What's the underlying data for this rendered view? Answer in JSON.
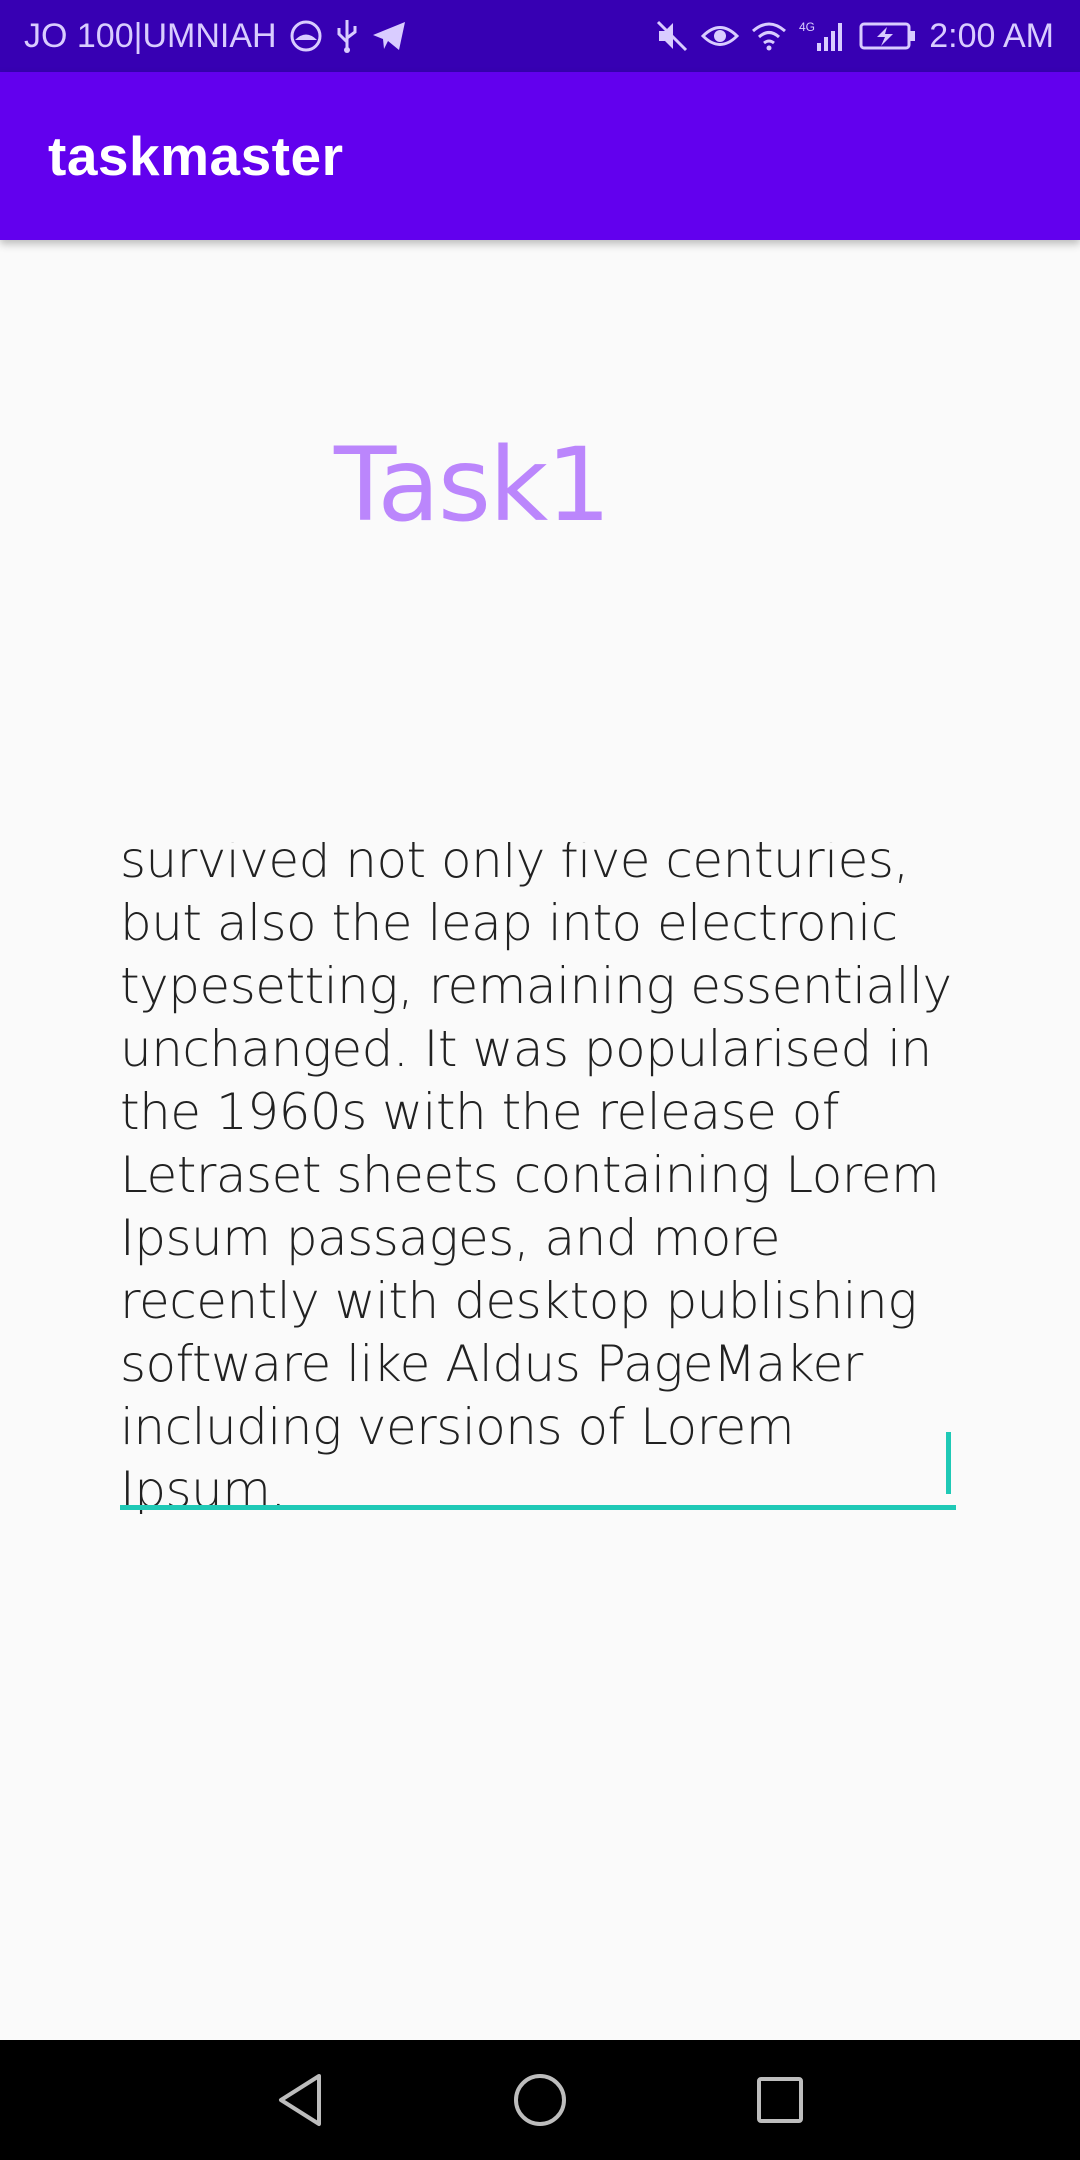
{
  "status_bar": {
    "carrier": "JO 100|UMNIAH",
    "time": "2:00 AM",
    "network_type": "4G",
    "icons_left": [
      "vpn-globe-icon",
      "usb-icon",
      "telegram-icon"
    ],
    "icons_right": [
      "mute-icon",
      "eye-comfort-icon",
      "wifi-icon",
      "signal-icon",
      "battery-charging-icon"
    ]
  },
  "app_bar": {
    "title": "taskmaster"
  },
  "task": {
    "title": "Task1",
    "body": "typespecimen book. It has survived not only five centuries, but also the leap into electronic typesetting, remaining essentially unchanged. It was popularised in the 1960s with the release of Letraset sheets containing Lorem Ipsum passages, and more recently with desktop publishing software like Aldus PageMaker including versions of Lorem Ipsum."
  },
  "nav_bar": {
    "buttons": [
      "back-icon",
      "home-icon",
      "recents-icon"
    ]
  },
  "colors": {
    "status_bar": "#3700b3",
    "app_bar": "#6200ee",
    "title_accent": "#bb86fc",
    "field_accent": "#1fc9b6",
    "background": "#fafafa"
  }
}
